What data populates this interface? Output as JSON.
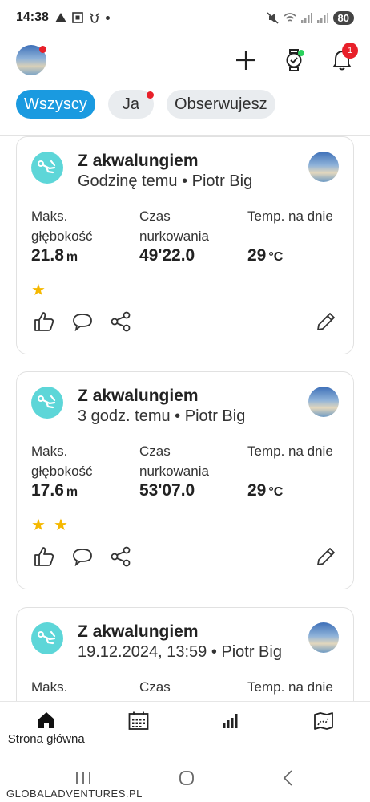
{
  "status_bar": {
    "time": "14:38",
    "battery": "80"
  },
  "header": {
    "notifications_count": "1"
  },
  "filters": [
    {
      "label": "Wszyscy",
      "active": true
    },
    {
      "label": "Ja",
      "active": false
    },
    {
      "label": "Obserwujesz",
      "active": false
    }
  ],
  "stat_labels": {
    "depth_line1": "Maks.",
    "depth_line2": "głębokość",
    "time_line1": "Czas",
    "time_line2": "nurkowania",
    "temp": "Temp. na dnie"
  },
  "cards": [
    {
      "title": "Z akwalungiem",
      "subtitle": "Godzinę temu • Piotr Big",
      "depth": "21.8",
      "depth_unit": "m",
      "duration": "49'22.0",
      "temp": "29",
      "temp_unit": "°C",
      "stars": 1
    },
    {
      "title": "Z akwalungiem",
      "subtitle": "3 godz. temu • Piotr Big",
      "depth": "17.6",
      "depth_unit": "m",
      "duration": "53'07.0",
      "temp": "29",
      "temp_unit": "°C",
      "stars": 2
    },
    {
      "title": "Z akwalungiem",
      "subtitle": "19.12.2024, 13:59 • Piotr Big"
    }
  ],
  "bottom_nav": [
    {
      "label": "Strona główna",
      "icon": "home-icon"
    },
    {
      "label": "",
      "icon": "calendar-icon"
    },
    {
      "label": "",
      "icon": "stats-icon"
    },
    {
      "label": "",
      "icon": "map-icon"
    }
  ],
  "watermark": "GLOBALADVENTURES.PL"
}
